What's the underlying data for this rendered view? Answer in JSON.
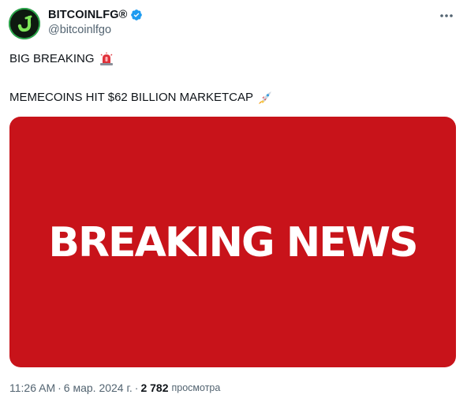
{
  "author": {
    "display_name": "BITCOINLFG®",
    "handle": "@bitcoinlfgo",
    "verified": true,
    "verified_color": "#1d9bf0",
    "avatar_colors": {
      "background": "#0e1a10",
      "ring": "#2aa84a",
      "mark": "#7ee85a"
    }
  },
  "tweet": {
    "line1": "BIG BREAKING",
    "line1_emoji": "rotating-light-icon",
    "line2": "MEMECOINS HIT $62 BILLION MARKETCAP",
    "line2_emoji": "rocket-icon"
  },
  "media": {
    "text": "BREAKING NEWS",
    "background_color": "#c8131a",
    "text_color": "#ffffff"
  },
  "meta": {
    "time": "11:26 AM",
    "date": "6 мар. 2024 г.",
    "views_count": "2 782",
    "views_label": "просмотра"
  },
  "icons": {
    "more": "more-dots-icon"
  }
}
